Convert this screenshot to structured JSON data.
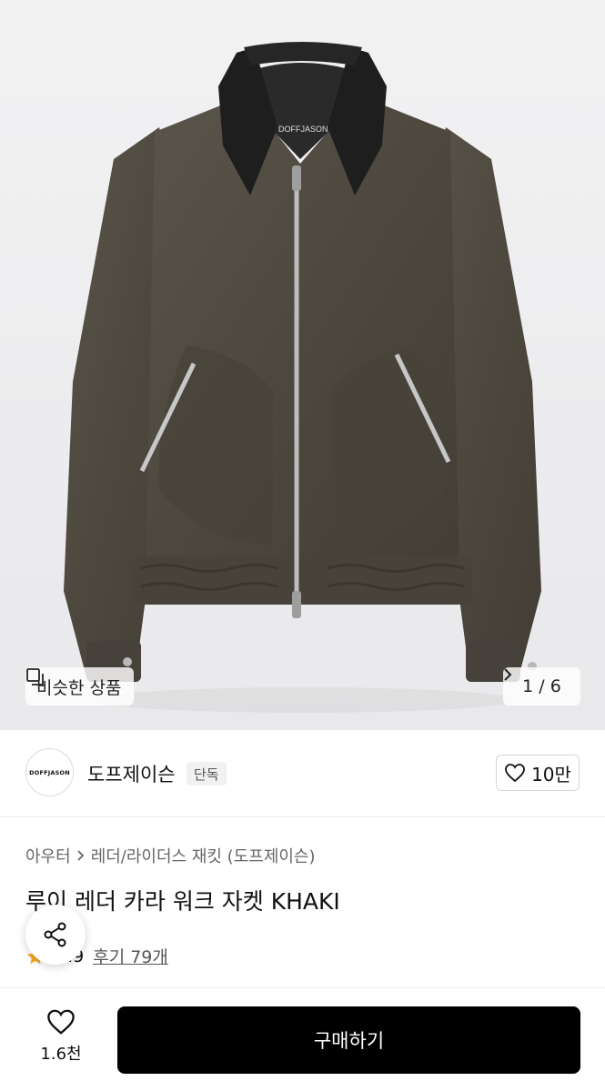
{
  "product_image": {
    "alt_brand_label": "DOFFJASON",
    "similar_button_label": "비슷한 상품",
    "pager": "1 / 6"
  },
  "brand": {
    "logo_text": "DOFFJASON",
    "name": "도프제이슨",
    "tag": "단독",
    "like_count": "10만"
  },
  "breadcrumb": {
    "category": "아우터",
    "subcategory": "레더/라이더스 재킷 (도프제이슨)"
  },
  "product": {
    "title": "루이 레더 카라 워크 자켓 KHAKI",
    "rating": "4.9",
    "reviews": "후기 79개"
  },
  "bottom_bar": {
    "wish_count": "1.6천",
    "buy_label": "구매하기"
  },
  "colors": {
    "jacket": "#4f4a40",
    "collar": "#1e1e1e",
    "star": "#f5a623",
    "buy_button": "#000000"
  }
}
